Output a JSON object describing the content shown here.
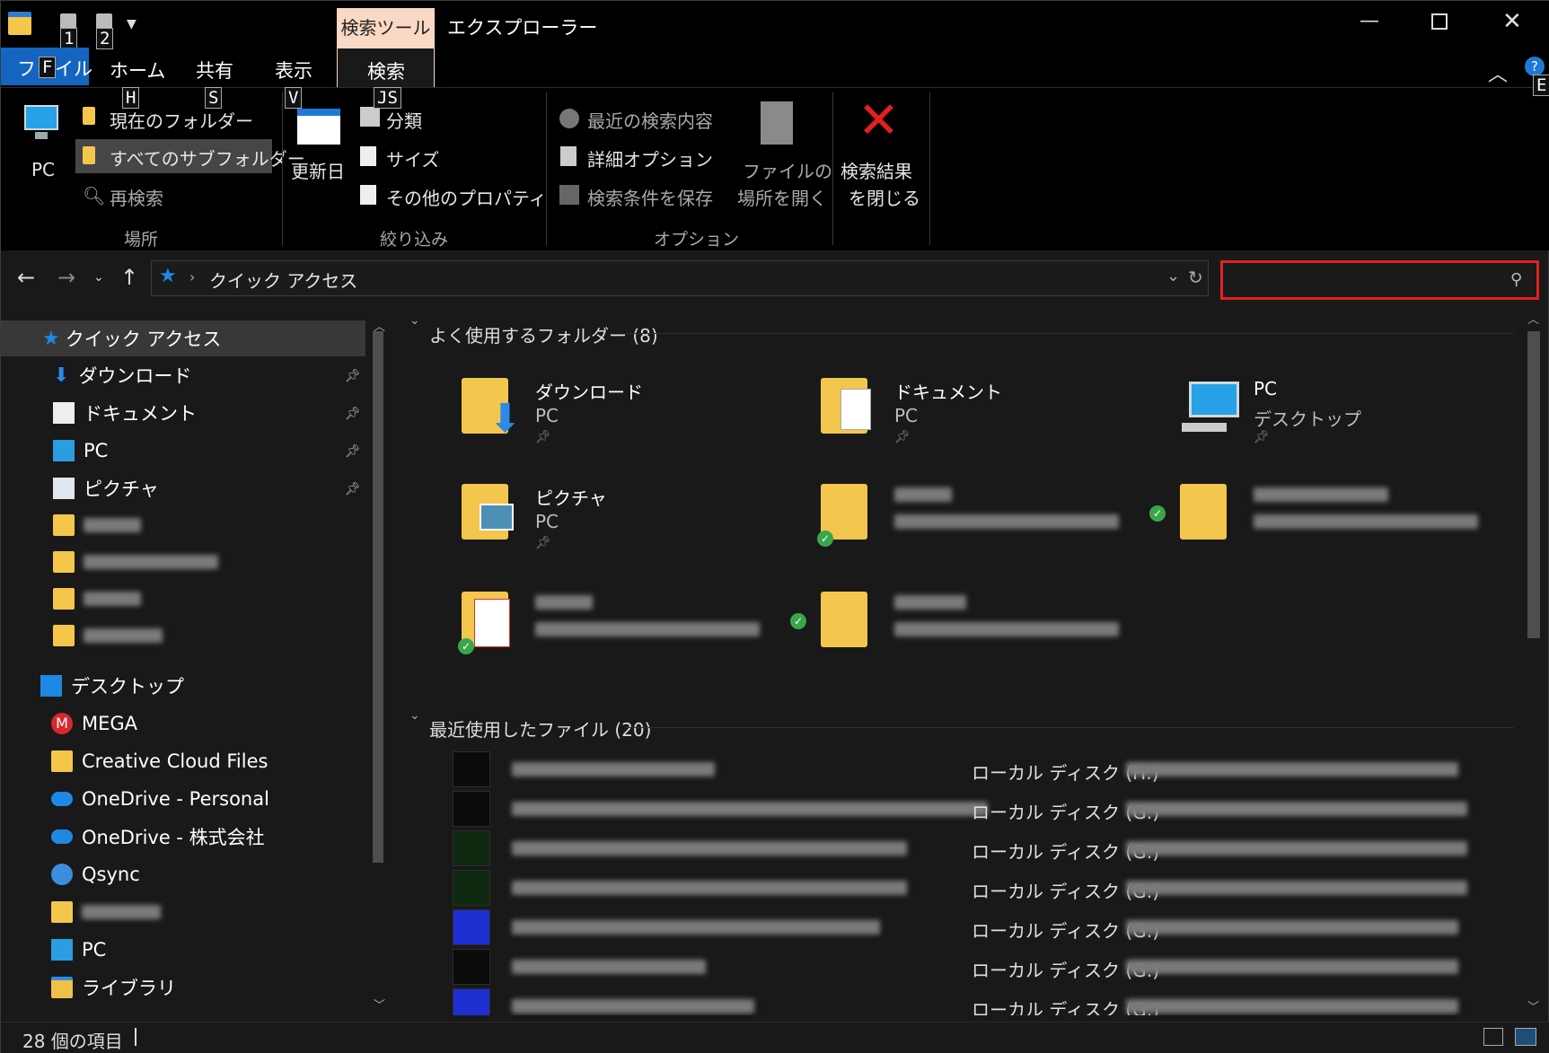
{
  "window": {
    "title": "エクスプローラー"
  },
  "qat_keytips": [
    "1",
    "2"
  ],
  "tabs": {
    "file": "ファイル",
    "home": "ホーム",
    "share": "共有",
    "view": "表示",
    "context": "検索ツール",
    "search": "検索",
    "keytips": {
      "file": "F",
      "home": "H",
      "share": "S",
      "view": "V",
      "search": "JS",
      "help": "E"
    }
  },
  "ribbon": {
    "location": {
      "pc": "PC",
      "current_folder": "現在のフォルダー",
      "all_subfolders": "すべてのサブフォルダー",
      "search_again": "再検索",
      "group": "場所"
    },
    "refine": {
      "date_modified": "更新日",
      "kind": "分類",
      "size": "サイズ",
      "other_props": "その他のプロパティ",
      "group": "絞り込み"
    },
    "options": {
      "recent_searches": "最近の検索内容",
      "advanced": "詳細オプション",
      "save_search": "検索条件を保存",
      "open_location_1": "ファイルの",
      "open_location_2": "場所を開く",
      "group": "オプション"
    },
    "close": {
      "line1": "検索結果",
      "line2": "を閉じる"
    }
  },
  "address": {
    "crumb": "クイック アクセス",
    "search_placeholder": ""
  },
  "nav": {
    "quick_access": "クイック アクセス",
    "items": [
      "ダウンロード",
      "ドキュメント",
      "PC",
      "ピクチャ"
    ],
    "desktop": "デスクトップ",
    "mega": "MEGA",
    "creative_cloud": "Creative Cloud Files",
    "onedrive_personal": "OneDrive - Personal",
    "onedrive_company": "OneDrive - 株式会社",
    "qsync": "Qsync",
    "pc": "PC",
    "library": "ライブラリ"
  },
  "content": {
    "frequent_header": "よく使用するフォルダー (8)",
    "recent_header": "最近使用したファイル (20)",
    "tiles": [
      {
        "name": "ダウンロード",
        "sub": "PC"
      },
      {
        "name": "ドキュメント",
        "sub": "PC"
      },
      {
        "name": "PC",
        "sub": "デスクトップ"
      },
      {
        "name": "ピクチャ",
        "sub": "PC"
      }
    ],
    "recent_locations": [
      "ローカル ディスク (H:)",
      "ローカル ディスク (G:)",
      "ローカル ディスク (G:)",
      "ローカル ディスク (G:)",
      "ローカル ディスク (G:)",
      "ローカル ディスク (G:)",
      "ローカル ディスク (G:)"
    ]
  },
  "status": {
    "count": "28 個の項目"
  },
  "colors": {
    "accent": "#0078d7",
    "search_highlight": "#e3201e",
    "context_tab": "#f9d8c4",
    "folder": "#f4c64a"
  }
}
